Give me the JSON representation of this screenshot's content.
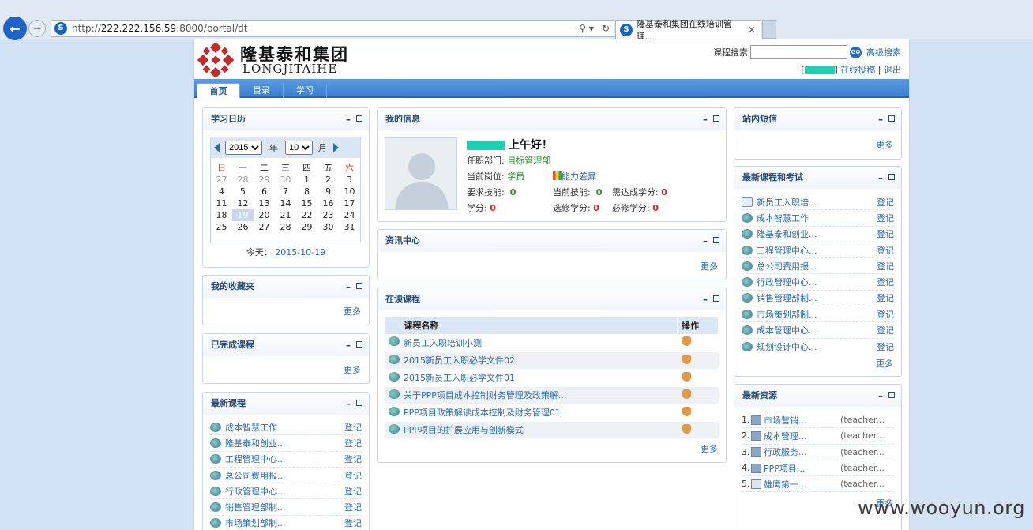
{
  "browser": {
    "url_prefix": "http://",
    "url_host": "222.222.156.59",
    "url_rest": ":8000/portal/dt",
    "tab_title": "隆基泰和集团在线培训管理..."
  },
  "header": {
    "logo_cn": "隆基泰和集团",
    "logo_en": "LONGJITAIHE",
    "search_label": "课程搜索",
    "search_go": "GO",
    "advanced_search": "高级搜索",
    "online_submit": "在线投稿",
    "logout": "退出"
  },
  "menu": [
    "首页",
    "目录",
    "学习"
  ],
  "calendar": {
    "title": "学习日历",
    "year": "2015",
    "year_label": "年",
    "month": "10",
    "month_label": "月",
    "weekdays": [
      "日",
      "一",
      "二",
      "三",
      "四",
      "五",
      "六"
    ],
    "weeks": [
      [
        "27",
        "28",
        "29",
        "30",
        "1",
        "2",
        "3"
      ],
      [
        "4",
        "5",
        "6",
        "7",
        "8",
        "9",
        "10"
      ],
      [
        "11",
        "12",
        "13",
        "14",
        "15",
        "16",
        "17"
      ],
      [
        "18",
        "19",
        "20",
        "21",
        "22",
        "23",
        "24"
      ],
      [
        "25",
        "26",
        "27",
        "28",
        "29",
        "30",
        "31"
      ]
    ],
    "today_label": "今天：",
    "today_value": "2015-10-19"
  },
  "favorites": {
    "title": "我的收藏夹",
    "more": "更多"
  },
  "completed": {
    "title": "已完成课程",
    "more": "更多"
  },
  "latest_courses_left": {
    "title": "最新课程",
    "items": [
      {
        "name": "成本智慧工作",
        "action": "登记"
      },
      {
        "name": "隆基泰和创业...",
        "action": "登记"
      },
      {
        "name": "工程管理中心...",
        "action": "登记"
      },
      {
        "name": "总公司费用报...",
        "action": "登记"
      },
      {
        "name": "行政管理中心...",
        "action": "登记"
      },
      {
        "name": "销售管理部制...",
        "action": "登记"
      },
      {
        "name": "市场策划部制...",
        "action": "登记"
      }
    ]
  },
  "my_info": {
    "title": "我的信息",
    "greeting": "上午好！",
    "dept_label": "任职部门:",
    "dept": "目标管理部",
    "post_label": "当前岗位:",
    "post": "学员",
    "gap_link": "能力差异",
    "req_skill_label": "要求技能:",
    "req_skill": "0",
    "cur_skill_label": "当前技能:",
    "cur_skill": "0",
    "need_credit_label": "需达成学分:",
    "need_credit": "0",
    "credit_label": "学分:",
    "credit": "0",
    "elective_label": "选修学分:",
    "elective": "0",
    "required_label": "必修学分:",
    "required": "0"
  },
  "news": {
    "title": "资讯中心",
    "more": "更多"
  },
  "reading": {
    "title": "在读课程",
    "col_name": "课程名称",
    "col_op": "操作",
    "rows": [
      "新员工入职培训小测",
      "2015新员工入职必学文件02",
      "2015新员工入职必学文件01",
      "关于PPP项目成本控制财务管理及政策解...",
      "PPP项目政策解读成本控制及财务管理01",
      "PPP项目的扩展应用与创新模式"
    ],
    "more": "更多"
  },
  "messages": {
    "title": "站内短信",
    "more": "更多"
  },
  "latest_exams": {
    "title": "最新课程和考试",
    "items": [
      {
        "name": "新员工入职培...",
        "action": "登记"
      },
      {
        "name": "成本智慧工作",
        "action": "登记"
      },
      {
        "name": "隆基泰和创业...",
        "action": "登记"
      },
      {
        "name": "工程管理中心...",
        "action": "登记"
      },
      {
        "name": "总公司费用报...",
        "action": "登记"
      },
      {
        "name": "行政管理中心...",
        "action": "登记"
      },
      {
        "name": "销售管理部制...",
        "action": "登记"
      },
      {
        "name": "市场策划部制...",
        "action": "登记"
      },
      {
        "name": "成本管理中心...",
        "action": "登记"
      },
      {
        "name": "规划设计中心...",
        "action": "登记"
      }
    ],
    "more": "更多"
  },
  "resources": {
    "title": "最新资源",
    "items": [
      {
        "n": "1.",
        "name": "市场营销...",
        "who": "(teacher..."
      },
      {
        "n": "2.",
        "name": "成本管理...",
        "who": "(teacher..."
      },
      {
        "n": "3.",
        "name": "行政服务...",
        "who": "(teacher..."
      },
      {
        "n": "4.",
        "name": "PPP项目...",
        "who": "(teacher..."
      },
      {
        "n": "5.",
        "name": "雄鹰第一...",
        "who": "(teacher..."
      }
    ],
    "more": "更多"
  },
  "watermark": "www.wooyun.org"
}
